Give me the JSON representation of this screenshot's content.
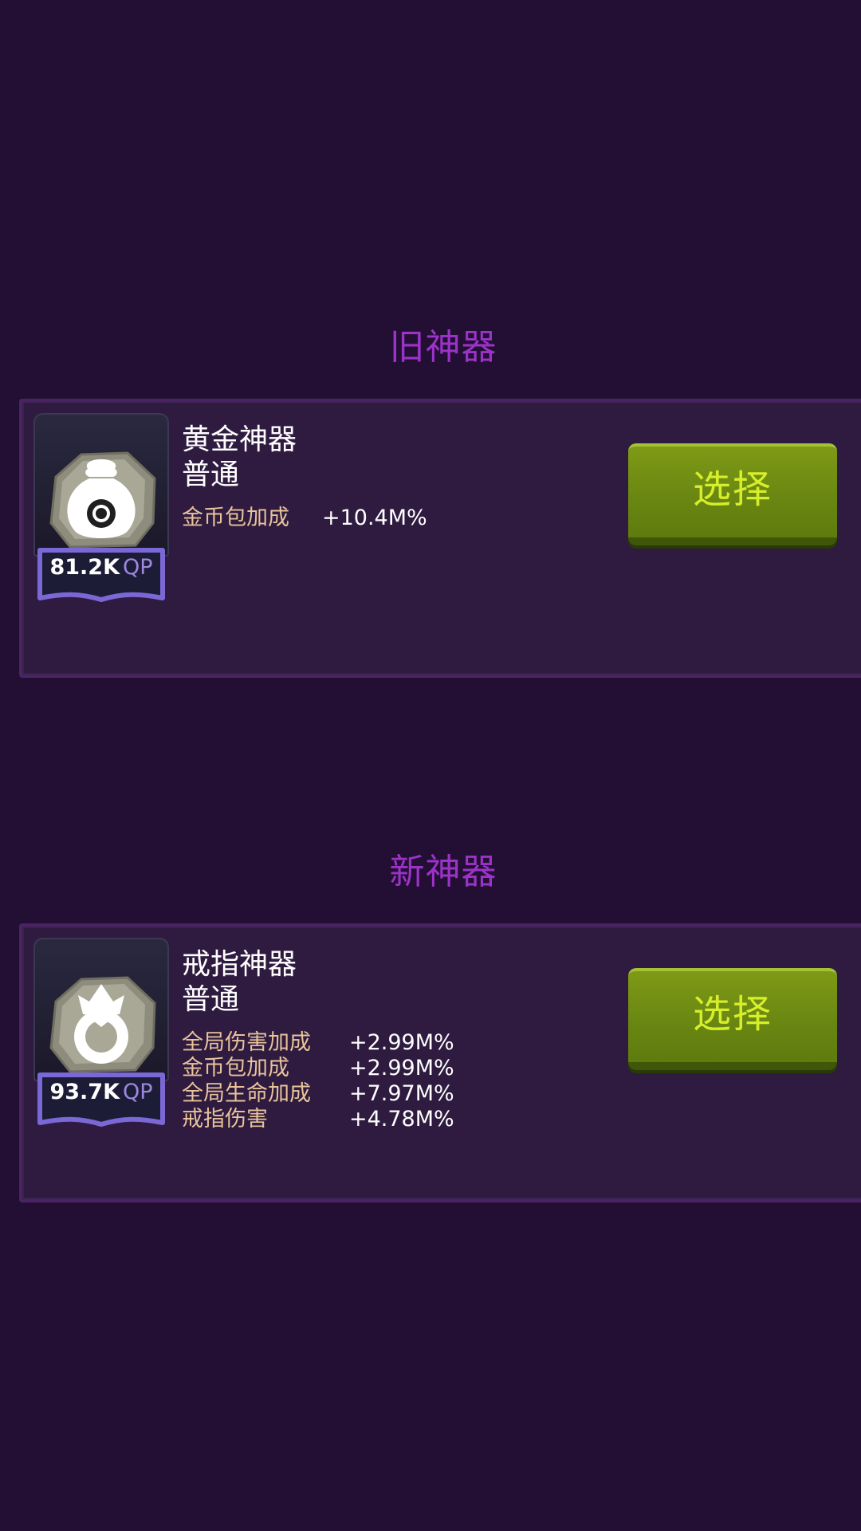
{
  "old_section": {
    "title": "旧神器",
    "artifact": {
      "name": "黄金神器",
      "rarity": "普通",
      "icon": "money-bag-icon",
      "qp_value": "81.2K",
      "qp_unit": "QP",
      "select_label": "选择",
      "stats": [
        {
          "label": "金币包加成",
          "value": "+10.4M%"
        }
      ]
    }
  },
  "new_section": {
    "title": "新神器",
    "artifact": {
      "name": "戒指神器",
      "rarity": "普通",
      "icon": "ring-icon",
      "qp_value": "93.7K",
      "qp_unit": "QP",
      "select_label": "选择",
      "stats": [
        {
          "label": "全局伤害加成",
          "value": "+2.99M%"
        },
        {
          "label": "金币包加成",
          "value": "+2.99M%"
        },
        {
          "label": "全局生命加成",
          "value": "+7.97M%"
        },
        {
          "label": "戒指伤害",
          "value": "+4.78M%"
        }
      ]
    }
  },
  "colors": {
    "background": "#230f33",
    "section_title": "#9b33c9",
    "card": "#2f1b40",
    "stat_label": "#e8c39a",
    "button": "#6a8712",
    "button_text": "#d7ee2a",
    "qp_accent": "#9d88e0"
  }
}
